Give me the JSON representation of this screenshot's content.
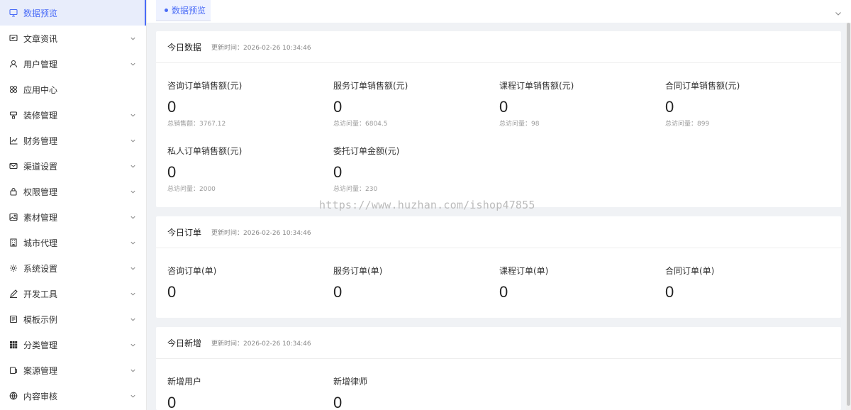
{
  "sidebar": {
    "items": [
      {
        "label": "数据预览",
        "icon": "monitor-icon",
        "active": true,
        "expandable": false
      },
      {
        "label": "文章资讯",
        "icon": "message-icon",
        "expandable": true
      },
      {
        "label": "用户管理",
        "icon": "user-icon",
        "expandable": true
      },
      {
        "label": "应用中心",
        "icon": "apps-icon",
        "expandable": false
      },
      {
        "label": "装修管理",
        "icon": "brush-icon",
        "expandable": true
      },
      {
        "label": "财务管理",
        "icon": "chart-icon",
        "expandable": true
      },
      {
        "label": "渠道设置",
        "icon": "mail-icon",
        "expandable": true
      },
      {
        "label": "权限管理",
        "icon": "lock-icon",
        "expandable": true
      },
      {
        "label": "素材管理",
        "icon": "image-icon",
        "expandable": true
      },
      {
        "label": "城市代理",
        "icon": "building-icon",
        "expandable": true
      },
      {
        "label": "系统设置",
        "icon": "gear-icon",
        "expandable": true
      },
      {
        "label": "开发工具",
        "icon": "pen-icon",
        "expandable": true
      },
      {
        "label": "模板示例",
        "icon": "template-icon",
        "expandable": true
      },
      {
        "label": "分类管理",
        "icon": "grid-icon",
        "expandable": true
      },
      {
        "label": "案源管理",
        "icon": "file-icon",
        "expandable": true
      },
      {
        "label": "内容审核",
        "icon": "globe-icon",
        "expandable": true
      }
    ]
  },
  "tabs": {
    "active_label": "数据预览"
  },
  "accent": "#4a6cf7",
  "watermark": "https://www.huzhan.com/ishop47855",
  "sections": {
    "today_data": {
      "title": "今日数据",
      "time": "更新时间：2026-02-26 10:34:46",
      "stats": [
        {
          "label": "咨询订单销售额(元)",
          "value": "0",
          "sub": "总销售额：3767.12"
        },
        {
          "label": "服务订单销售额(元)",
          "value": "0",
          "sub": "总访问量：6804.5"
        },
        {
          "label": "课程订单销售额(元)",
          "value": "0",
          "sub": "总访问量：98"
        },
        {
          "label": "合同订单销售额(元)",
          "value": "0",
          "sub": "总访问量：899"
        },
        {
          "label": "私人订单销售额(元)",
          "value": "0",
          "sub": "总访问量：2000"
        },
        {
          "label": "委托订单金额(元)",
          "value": "0",
          "sub": "总访问量：230"
        }
      ]
    },
    "today_orders": {
      "title": "今日订单",
      "time": "更新时间：2026-02-26 10:34:46",
      "stats": [
        {
          "label": "咨询订单(单)",
          "value": "0"
        },
        {
          "label": "服务订单(单)",
          "value": "0"
        },
        {
          "label": "课程订单(单)",
          "value": "0"
        },
        {
          "label": "合同订单(单)",
          "value": "0"
        }
      ]
    },
    "today_new": {
      "title": "今日新增",
      "time": "更新时间：2026-02-26 10:34:46",
      "stats": [
        {
          "label": "新增用户",
          "value": "0"
        },
        {
          "label": "新增律师",
          "value": "0"
        }
      ]
    }
  }
}
